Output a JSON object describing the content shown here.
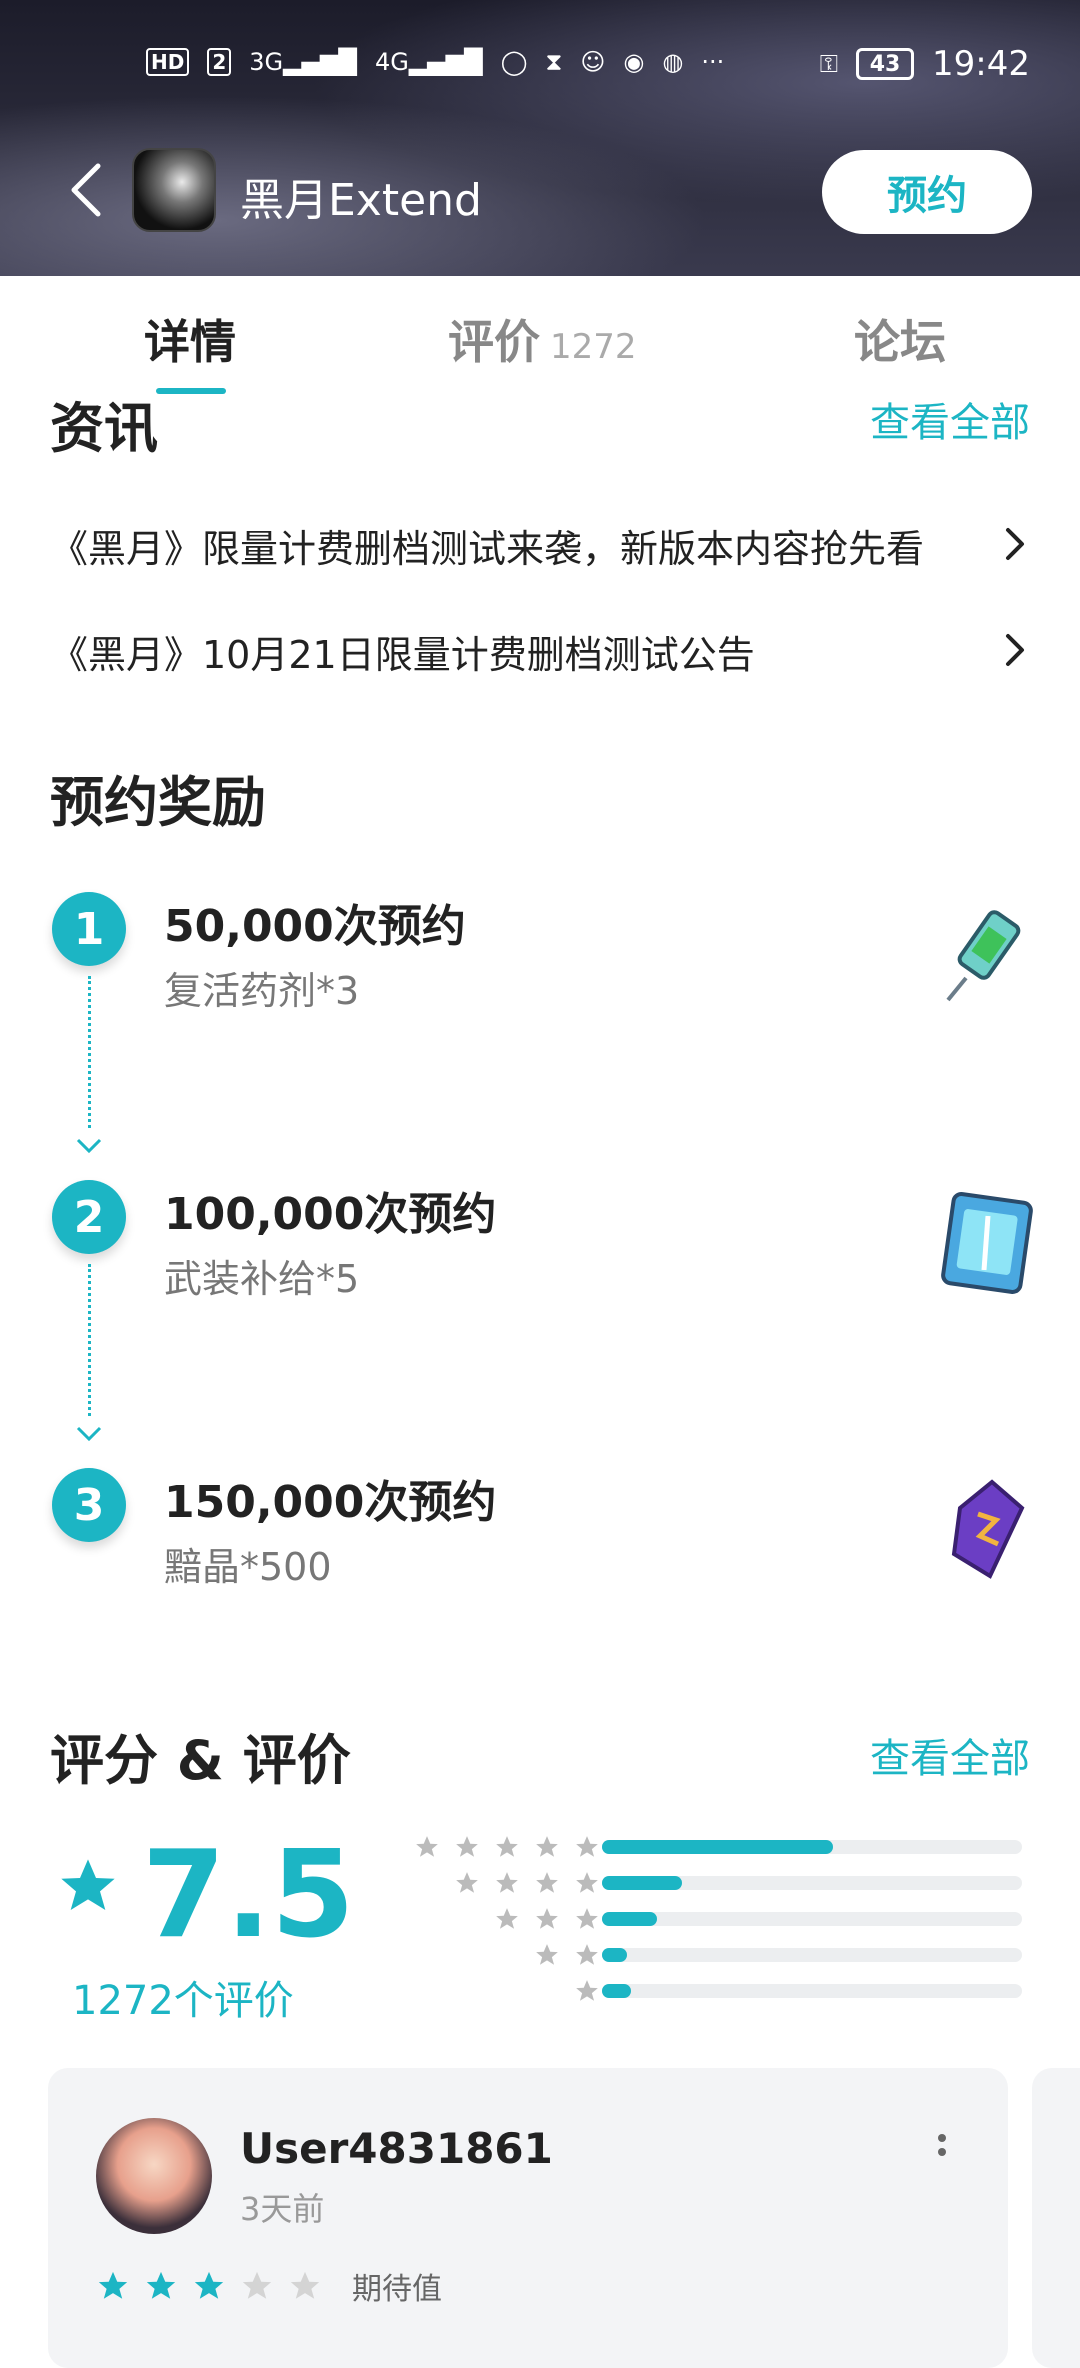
{
  "status_bar": {
    "left_icons": [
      "HD",
      "2",
      "3G",
      "4G",
      "qq-icon",
      "hourglass-icon",
      "avatar-icon",
      "app-icon",
      "browser-icon",
      "···"
    ],
    "battery": "43",
    "time": "19:42"
  },
  "header": {
    "title": "黑月Extend",
    "reserve_label": "预约"
  },
  "tabs": [
    {
      "label": "详情",
      "active": true
    },
    {
      "label": "评价",
      "count": "1272",
      "active": false
    },
    {
      "label": "论坛",
      "active": false
    }
  ],
  "news": {
    "title": "资讯",
    "see_all": "查看全部",
    "items": [
      "《黑月》限量计费删档测试来袭，新版本内容抢先看",
      "《黑月》10月21日限量计费删档测试公告"
    ]
  },
  "rewards": {
    "title": "预约奖励",
    "items": [
      {
        "step": "1",
        "title": "50,000次预约",
        "sub": "复活药剂*3"
      },
      {
        "step": "2",
        "title": "100,000次预约",
        "sub": "武装补给*5"
      },
      {
        "step": "3",
        "title": "150,000次预约",
        "sub": "黯晶*500"
      }
    ]
  },
  "ratings": {
    "title": "评分 & 评价",
    "see_all": "查看全部",
    "score": "7.5",
    "count_label": "1272个评价",
    "distribution": [
      {
        "stars": 5,
        "fraction": 0.55
      },
      {
        "stars": 4,
        "fraction": 0.19
      },
      {
        "stars": 3,
        "fraction": 0.13
      },
      {
        "stars": 2,
        "fraction": 0.06
      },
      {
        "stars": 1,
        "fraction": 0.07
      }
    ]
  },
  "review": {
    "user": "User4831861",
    "time": "3天前",
    "stars": 3,
    "label": "期待值"
  },
  "colors": {
    "accent": "#1cb5c4"
  }
}
